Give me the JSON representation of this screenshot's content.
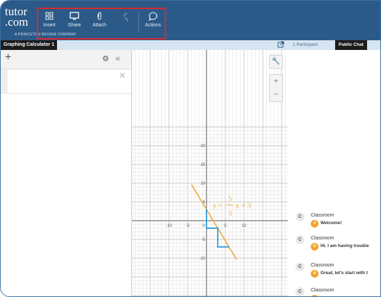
{
  "app": {
    "logo_line1": "tutor",
    "logo_line2": ".com",
    "logo_tag": "A PRINCETON REVIEW COMPANY"
  },
  "toolbar": {
    "items": [
      {
        "label": "Insert",
        "icon": "grid-icon"
      },
      {
        "label": "Share",
        "icon": "monitor-icon"
      },
      {
        "label": "Attach",
        "icon": "paperclip-icon"
      },
      {
        "label": "",
        "icon": "undo-redo-icon"
      },
      {
        "label": "Actions",
        "icon": "speech-bubble-icon"
      }
    ],
    "highlight_color": "#e0262b"
  },
  "tabs": {
    "active_doc": "Graphing Calculator 1",
    "participants": "1 Participant",
    "public_chat": "Public Chat"
  },
  "graph": {
    "x_ticks": [
      "-10",
      "-5",
      "0",
      "5",
      "10"
    ],
    "y_ticks": [
      "20",
      "15",
      "10",
      "5",
      "-5",
      "-10"
    ],
    "equation": {
      "lhs": "y = −",
      "num": "5",
      "den": "3",
      "rhs": "x + 3"
    },
    "line_color": "#f0b24a",
    "triangle_color": "#2b9ad8"
  },
  "chart_data": {
    "type": "line",
    "xlim": [
      -10,
      10
    ],
    "ylim": [
      -12,
      20
    ],
    "series": [
      {
        "values": [
          [
            -4,
            9.67
          ],
          [
            8,
            -10.33
          ]
        ]
      },
      {
        "values": [
          [
            0,
            3
          ],
          [
            0,
            -2
          ],
          [
            3,
            -2
          ],
          [
            3,
            -7
          ],
          [
            6,
            -7
          ]
        ]
      }
    ],
    "annotations": [
      "y = −5/3 x + 3"
    ]
  },
  "chat": {
    "messages": [
      {
        "sender": "Classroom",
        "avatar_letter": "d",
        "text": "Welcome!"
      },
      {
        "sender": "Classroom",
        "avatar_letter": "G",
        "text": "Hi. I am having trouble"
      },
      {
        "sender": "Classroom",
        "avatar_letter": "d",
        "text": "Great, let's start with t"
      },
      {
        "sender": "Classroom",
        "avatar_letter": "",
        "text": ""
      }
    ]
  }
}
